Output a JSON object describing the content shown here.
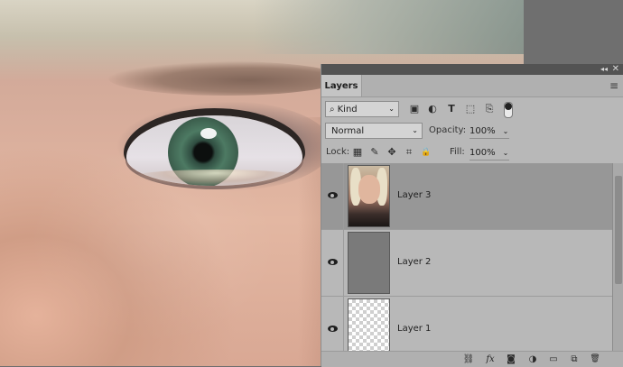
{
  "panel": {
    "tab_label": "Layers",
    "collapse_glyph": "◂◂",
    "close_glyph": "✕",
    "menu_glyph": "≡",
    "filter": {
      "kind_label": "Kind",
      "search_glyph": "⌕",
      "caret": "⌄",
      "icons": [
        {
          "name": "pixel-layer-filter-icon",
          "glyph": "▣"
        },
        {
          "name": "adjustment-layer-filter-icon",
          "glyph": "◐"
        },
        {
          "name": "type-layer-filter-icon",
          "glyph": "T"
        },
        {
          "name": "shape-layer-filter-icon",
          "glyph": "⬚"
        },
        {
          "name": "smart-object-filter-icon",
          "glyph": "⎘"
        }
      ]
    },
    "blend_mode": "Normal",
    "opacity_label": "Opacity:",
    "opacity_value": "100%",
    "lock_label": "Lock:",
    "lock_icons": [
      {
        "name": "lock-transparent-pixels-icon",
        "glyph": "▦"
      },
      {
        "name": "lock-image-pixels-icon",
        "glyph": "✎"
      },
      {
        "name": "lock-position-icon",
        "glyph": "✥"
      },
      {
        "name": "lock-artboard-icon",
        "glyph": "⌗"
      },
      {
        "name": "lock-all-icon",
        "glyph": "🔒"
      }
    ],
    "fill_label": "Fill:",
    "fill_value": "100%",
    "layers": [
      {
        "name": "Layer 3",
        "selected": true,
        "visible": true,
        "thumb": "photo"
      },
      {
        "name": "Layer 2",
        "selected": false,
        "visible": true,
        "thumb": "gray"
      },
      {
        "name": "Layer 1",
        "selected": false,
        "visible": true,
        "thumb": "transparent"
      }
    ],
    "bottom_icons": [
      {
        "name": "link-layers-icon",
        "glyph": "⛓"
      },
      {
        "name": "layer-style-icon",
        "glyph": "fx"
      },
      {
        "name": "add-mask-icon",
        "glyph": "◙"
      },
      {
        "name": "new-adjustment-layer-icon",
        "glyph": "◑"
      },
      {
        "name": "new-group-icon",
        "glyph": "▭"
      },
      {
        "name": "new-layer-icon",
        "glyph": "⧉"
      },
      {
        "name": "delete-layer-icon",
        "glyph": "🗑"
      }
    ]
  }
}
